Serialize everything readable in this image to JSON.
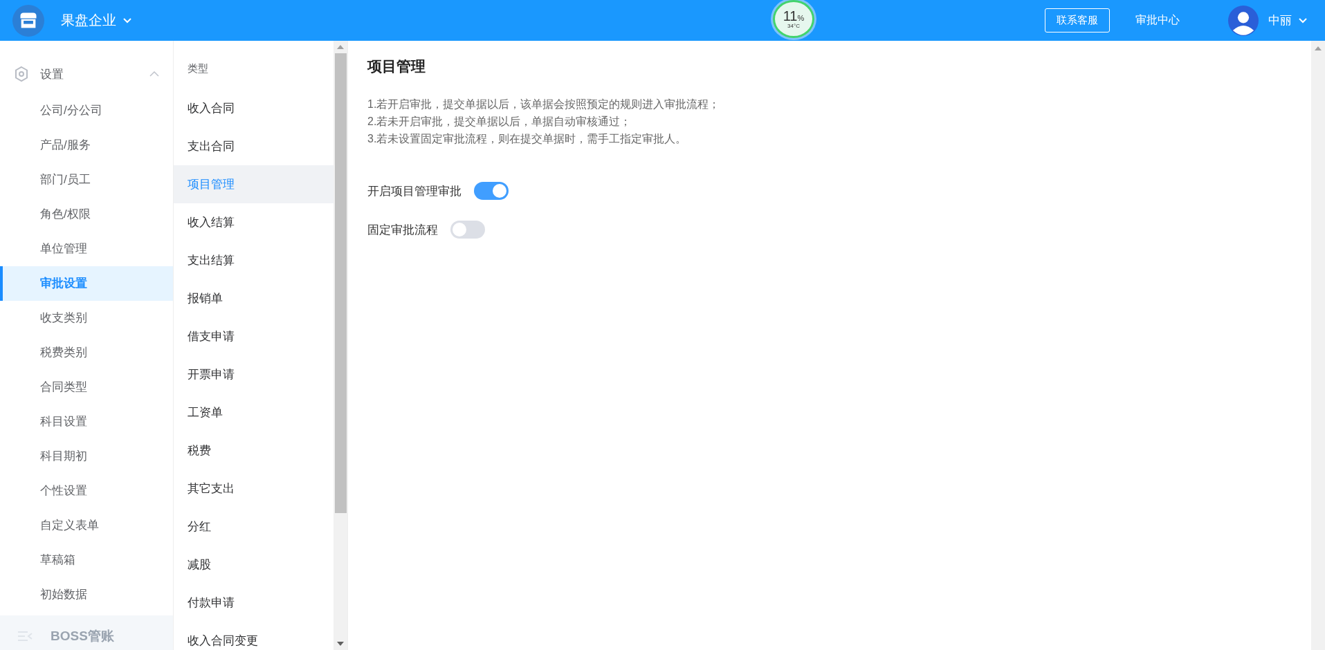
{
  "header": {
    "company": "果盘企业",
    "gauge": {
      "value": "11",
      "unit": "%",
      "temperature": "34°C"
    },
    "contact_button": "联系客服",
    "approval_center": "审批中心",
    "user": "中丽"
  },
  "sidebar": {
    "group": {
      "label": "设置",
      "expanded": true
    },
    "items": [
      {
        "label": "公司/分公司",
        "selected": false
      },
      {
        "label": "产品/服务",
        "selected": false
      },
      {
        "label": "部门/员工",
        "selected": false
      },
      {
        "label": "角色/权限",
        "selected": false
      },
      {
        "label": "单位管理",
        "selected": false
      },
      {
        "label": "审批设置",
        "selected": true
      },
      {
        "label": "收支类别",
        "selected": false
      },
      {
        "label": "税费类别",
        "selected": false
      },
      {
        "label": "合同类型",
        "selected": false
      },
      {
        "label": "科目设置",
        "selected": false
      },
      {
        "label": "科目期初",
        "selected": false
      },
      {
        "label": "个性设置",
        "selected": false
      },
      {
        "label": "自定义表单",
        "selected": false
      },
      {
        "label": "草稿箱",
        "selected": false
      },
      {
        "label": "初始数据",
        "selected": false
      }
    ],
    "footer": "BOSS管账"
  },
  "types": {
    "heading": "类型",
    "items": [
      {
        "label": "收入合同",
        "selected": false
      },
      {
        "label": "支出合同",
        "selected": false
      },
      {
        "label": "项目管理",
        "selected": true
      },
      {
        "label": "收入结算",
        "selected": false
      },
      {
        "label": "支出结算",
        "selected": false
      },
      {
        "label": "报销单",
        "selected": false
      },
      {
        "label": "借支申请",
        "selected": false
      },
      {
        "label": "开票申请",
        "selected": false
      },
      {
        "label": "工资单",
        "selected": false
      },
      {
        "label": "税费",
        "selected": false
      },
      {
        "label": "其它支出",
        "selected": false
      },
      {
        "label": "分红",
        "selected": false
      },
      {
        "label": "减股",
        "selected": false
      },
      {
        "label": "付款申请",
        "selected": false
      },
      {
        "label": "收入合同变更",
        "selected": false
      }
    ]
  },
  "content": {
    "title": "项目管理",
    "notes": [
      "1.若开启审批，提交单据以后，该单据会按照预定的规则进入审批流程；",
      "2.若未开启审批，提交单据以后，单据自动审核通过；",
      "3.若未设置固定审批流程，则在提交单据时，需手工指定审批人。"
    ],
    "settings": [
      {
        "label": "开启项目管理审批",
        "on": true
      },
      {
        "label": "固定审批流程",
        "on": false
      }
    ]
  }
}
